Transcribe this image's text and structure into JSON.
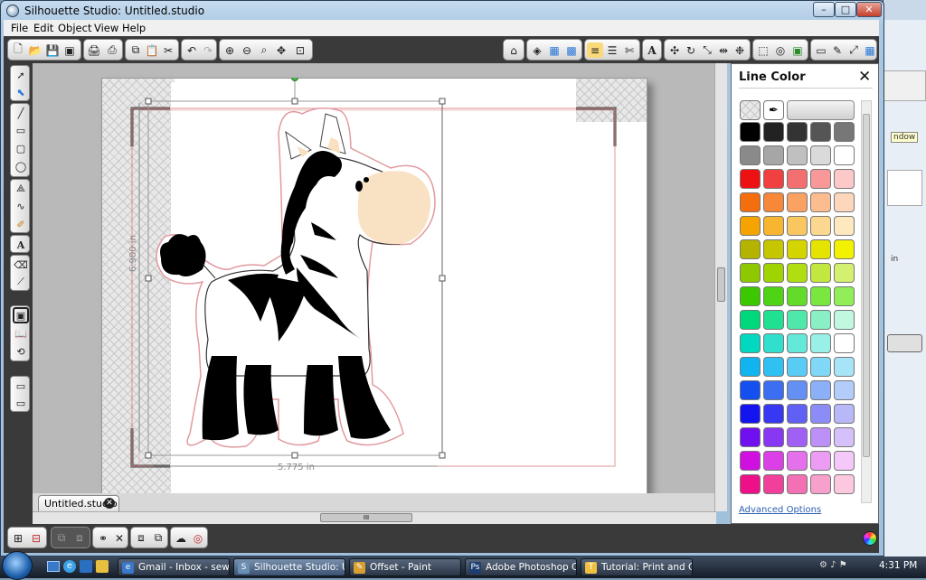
{
  "window": {
    "title": "Silhouette Studio: Untitled.studio"
  },
  "caption_buttons": {
    "minimize": "–",
    "maximize": "□",
    "close": "✕"
  },
  "menu": [
    "File",
    "Edit",
    "Object",
    "View",
    "Help"
  ],
  "document": {
    "tab_label": "Untitled.studio",
    "close_glyph": "✕",
    "height_label": "6.900 in",
    "width_label": "5.775 in"
  },
  "hscroll": {
    "grip": "III"
  },
  "panel": {
    "title": "Line Color",
    "close_glyph": "✕",
    "advanced_link": "Advanced Options",
    "swatch_rows": [
      [
        "#000000",
        "#222222",
        "#333333",
        "#555555",
        "#777777"
      ],
      [
        "#8a8a8a",
        "#a6a6a6",
        "#c0c0c0",
        "#dadada",
        "#ffffff"
      ],
      [
        "#ee1111",
        "#f04040",
        "#f47070",
        "#f89898",
        "#fcc8c8"
      ],
      [
        "#f46e0e",
        "#f7883a",
        "#f9a264",
        "#fbbd90",
        "#fdd7bb"
      ],
      [
        "#f5a300",
        "#f7b530",
        "#f9c660",
        "#fbd790",
        "#fde8c0"
      ],
      [
        "#b4b400",
        "#c5c500",
        "#d4d400",
        "#e4e400",
        "#f2f200"
      ],
      [
        "#8ec800",
        "#9fd400",
        "#b0de10",
        "#c2e840",
        "#d4f070"
      ],
      [
        "#3cc800",
        "#4ed414",
        "#62dc28",
        "#7ae640",
        "#92ee58"
      ],
      [
        "#00d87c",
        "#20e092",
        "#50e8aa",
        "#88f0c4",
        "#c0f8e0"
      ],
      [
        "#00d8c0",
        "#30e0cc",
        "#64e8d8",
        "#98f0e6",
        "#ffffff"
      ],
      [
        "#10b4ee",
        "#30c0f2",
        "#58ccf4",
        "#80d8f6",
        "#a8e4f8"
      ],
      [
        "#1450f0",
        "#3c6ef2",
        "#6490f4",
        "#8cb0f8",
        "#b4ccfa"
      ],
      [
        "#1414f0",
        "#3838f2",
        "#6060f4",
        "#8c8cf6",
        "#b8b8f8"
      ],
      [
        "#7010f0",
        "#8838f2",
        "#a060f4",
        "#bc90f6",
        "#d6c0fa"
      ],
      [
        "#d010e0",
        "#da40e6",
        "#e470ec",
        "#ec9cf2",
        "#f4c8f8"
      ],
      [
        "#ee1088",
        "#f0409c",
        "#f470b4",
        "#f8a0cc",
        "#fcc8e0"
      ]
    ]
  },
  "taskbar": {
    "items": [
      {
        "label": "Gmail - Inbox - sew...",
        "icon_color": "#3a78c8",
        "icon": "e"
      },
      {
        "label": "Silhouette Studio: U...",
        "icon_color": "#6a8fb3",
        "icon": "S"
      },
      {
        "label": "Offset - Paint",
        "icon_color": "#d8a030",
        "icon": "✎"
      },
      {
        "label": "Adobe Photoshop C...",
        "icon_color": "#1c3e70",
        "icon": "Ps"
      },
      {
        "label": "Tutorial: Print and C...",
        "icon_color": "#f0c040",
        "icon": "T"
      }
    ],
    "clock": "4:31 PM"
  },
  "background_window": {
    "text1": "ndow",
    "text2": "in"
  }
}
